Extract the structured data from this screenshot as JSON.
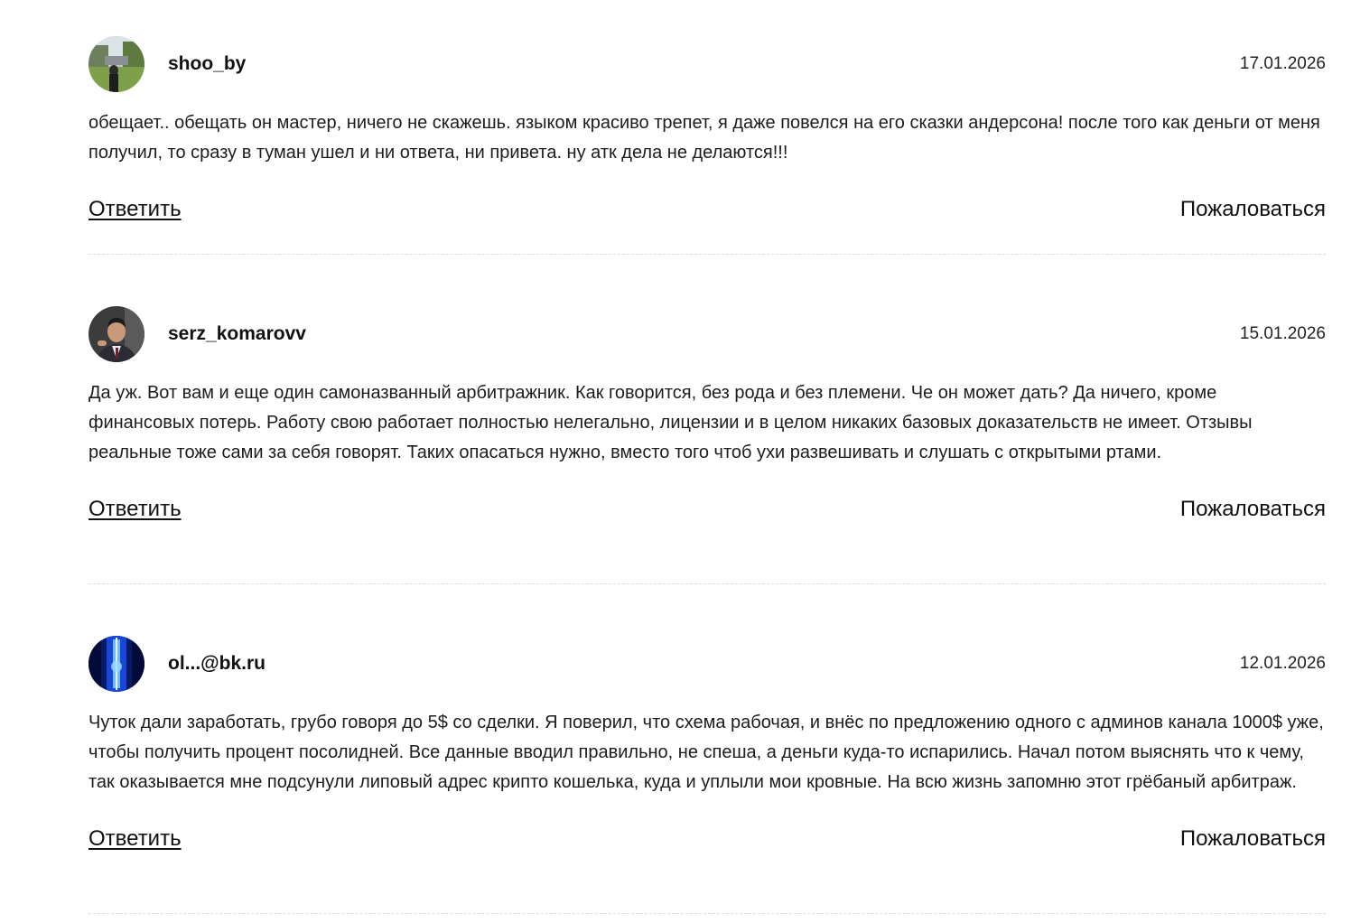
{
  "comments": [
    {
      "username": "shoo_by",
      "date": "17.01.2026",
      "avatar_icon": "avatar-park-photo",
      "text": "обещает.. обещать он мастер, ничего не скажешь. языком красиво трепет, я даже повелся на его сказки андерсона! после того как деньги от меня получил, то сразу в туман ушел и ни ответа, ни привета. ну атк дела не делаются!!!",
      "reply_label": "Ответить",
      "complain_label": "Пожаловаться"
    },
    {
      "username": "serz_komarovv",
      "date": "15.01.2026",
      "avatar_icon": "avatar-man-in-suit",
      "text": "Да уж. Вот вам и еще один самоназванный арбитражник. Как говорится, без рода и без племени. Че он может дать? Да ничего, кроме финансовых потерь. Работу свою работает полностью нелегально, лицензии и в целом никаких базовых доказательств не имеет. Отзывы реальные тоже сами за себя говорят. Таких опасаться нужно, вместо того чтоб ухи развешивать и слушать с открытыми ртами.",
      "reply_label": "Ответить",
      "complain_label": "Пожаловаться"
    },
    {
      "username": "ol...@bk.ru",
      "date": "12.01.2026",
      "avatar_icon": "avatar-blue-abstract",
      "text": "Чуток дали заработать, грубо говоря до 5$ со сделки. Я поверил, что схема рабочая, и внёс по предложению одного с админов канала 1000$ уже, чтобы получить процент посолидней. Все данные вводил правильно, не спеша, а деньги куда-то испарились. Начал потом выяснять что к чему, так оказывается мне подсунули липовый адрес крипто кошелька, куда и уплыли мои кровные. На всю жизнь запомню этот грёбаный арбитраж.",
      "reply_label": "Ответить",
      "complain_label": "Пожаловаться"
    }
  ]
}
